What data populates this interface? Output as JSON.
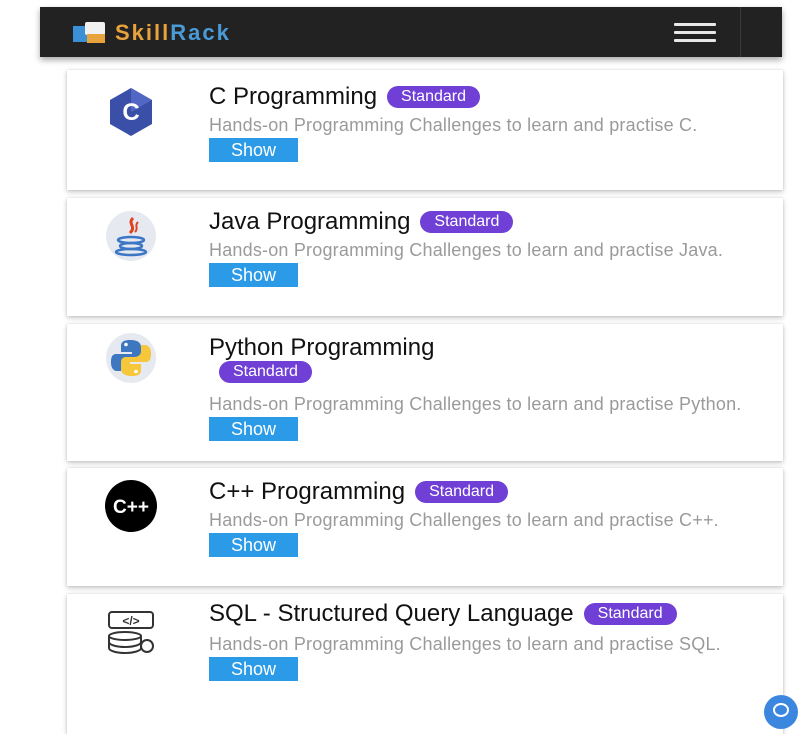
{
  "header": {
    "brand_part1": "Skill",
    "brand_part2": "Rack",
    "menu_icon": "hamburger-icon"
  },
  "courses": [
    {
      "title": "C Programming",
      "badge": "Standard",
      "description": "Hands-on Programming Challenges to learn and practise C.",
      "button": "Show",
      "icon": "c-language-icon"
    },
    {
      "title": "Java Programming",
      "badge": "Standard",
      "description": "Hands-on Programming Challenges to learn and practise Java.",
      "button": "Show",
      "icon": "java-icon"
    },
    {
      "title": "Python Programming",
      "badge": "Standard",
      "description": "Hands-on Programming Challenges to learn and practise Python.",
      "button": "Show",
      "icon": "python-icon"
    },
    {
      "title": "C++ Programming",
      "badge": "Standard",
      "description": "Hands-on Programming Challenges to learn and practise C++.",
      "button": "Show",
      "icon": "cpp-icon"
    },
    {
      "title": "SQL - Structured Query Language",
      "badge": "Standard",
      "description": "Hands-on Programming Challenges to learn and practise SQL.",
      "button": "Show",
      "icon": "sql-icon"
    }
  ],
  "colors": {
    "navbar": "#222222",
    "brand_orange": "#e8a33c",
    "brand_blue": "#4a9ad8",
    "badge": "#6f3fd6",
    "button": "#2b9be8"
  },
  "chat_icon": "chat-icon"
}
